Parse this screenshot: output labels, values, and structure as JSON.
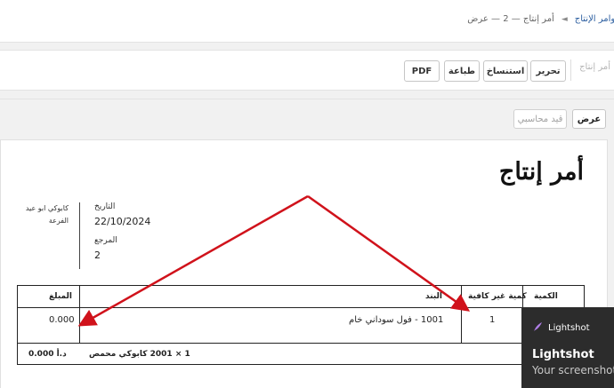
{
  "breadcrumb": {
    "parent": "أوامر الإنتاج",
    "separator": "◄",
    "current": "أمر إنتاج — 2 — عرض"
  },
  "toolbar": {
    "status": "أمر إنتاج",
    "edit_label": "تحرير",
    "duplicate_label": "استنساخ",
    "print_label": "طباعة",
    "pdf_label": "PDF"
  },
  "tabs": {
    "view_label": "عرض",
    "journal_label": "قيد محاسبي"
  },
  "document": {
    "title": "أمر إنتاج",
    "date_label": "التاريخ",
    "date_value": "22/10/2024",
    "reference_label": "المرجع",
    "reference_value": "2",
    "company_name": "كابوكي ابو عيد",
    "company_branch": "الفرعة",
    "table": {
      "headers": {
        "quantity": "الكمية",
        "insufficient_qty": "كمية غير كافية",
        "item": "البند",
        "amount": "المبلغ"
      },
      "rows": [
        {
          "quantity": "",
          "insufficient_qty": "1",
          "item": "1001 - فول سوداني خام",
          "amount": "0.000"
        }
      ],
      "footer": {
        "product": "1 × 2001 كابوكي محمص",
        "total": "د.أ 0.000"
      }
    }
  },
  "lightshot": {
    "brand": "Lightshot",
    "title": "Lightshot",
    "subtitle": "Your screenshot"
  },
  "colors": {
    "link": "#2a5d9f",
    "arrow": "#d0121b",
    "popup_bg": "#2c2c2c"
  }
}
